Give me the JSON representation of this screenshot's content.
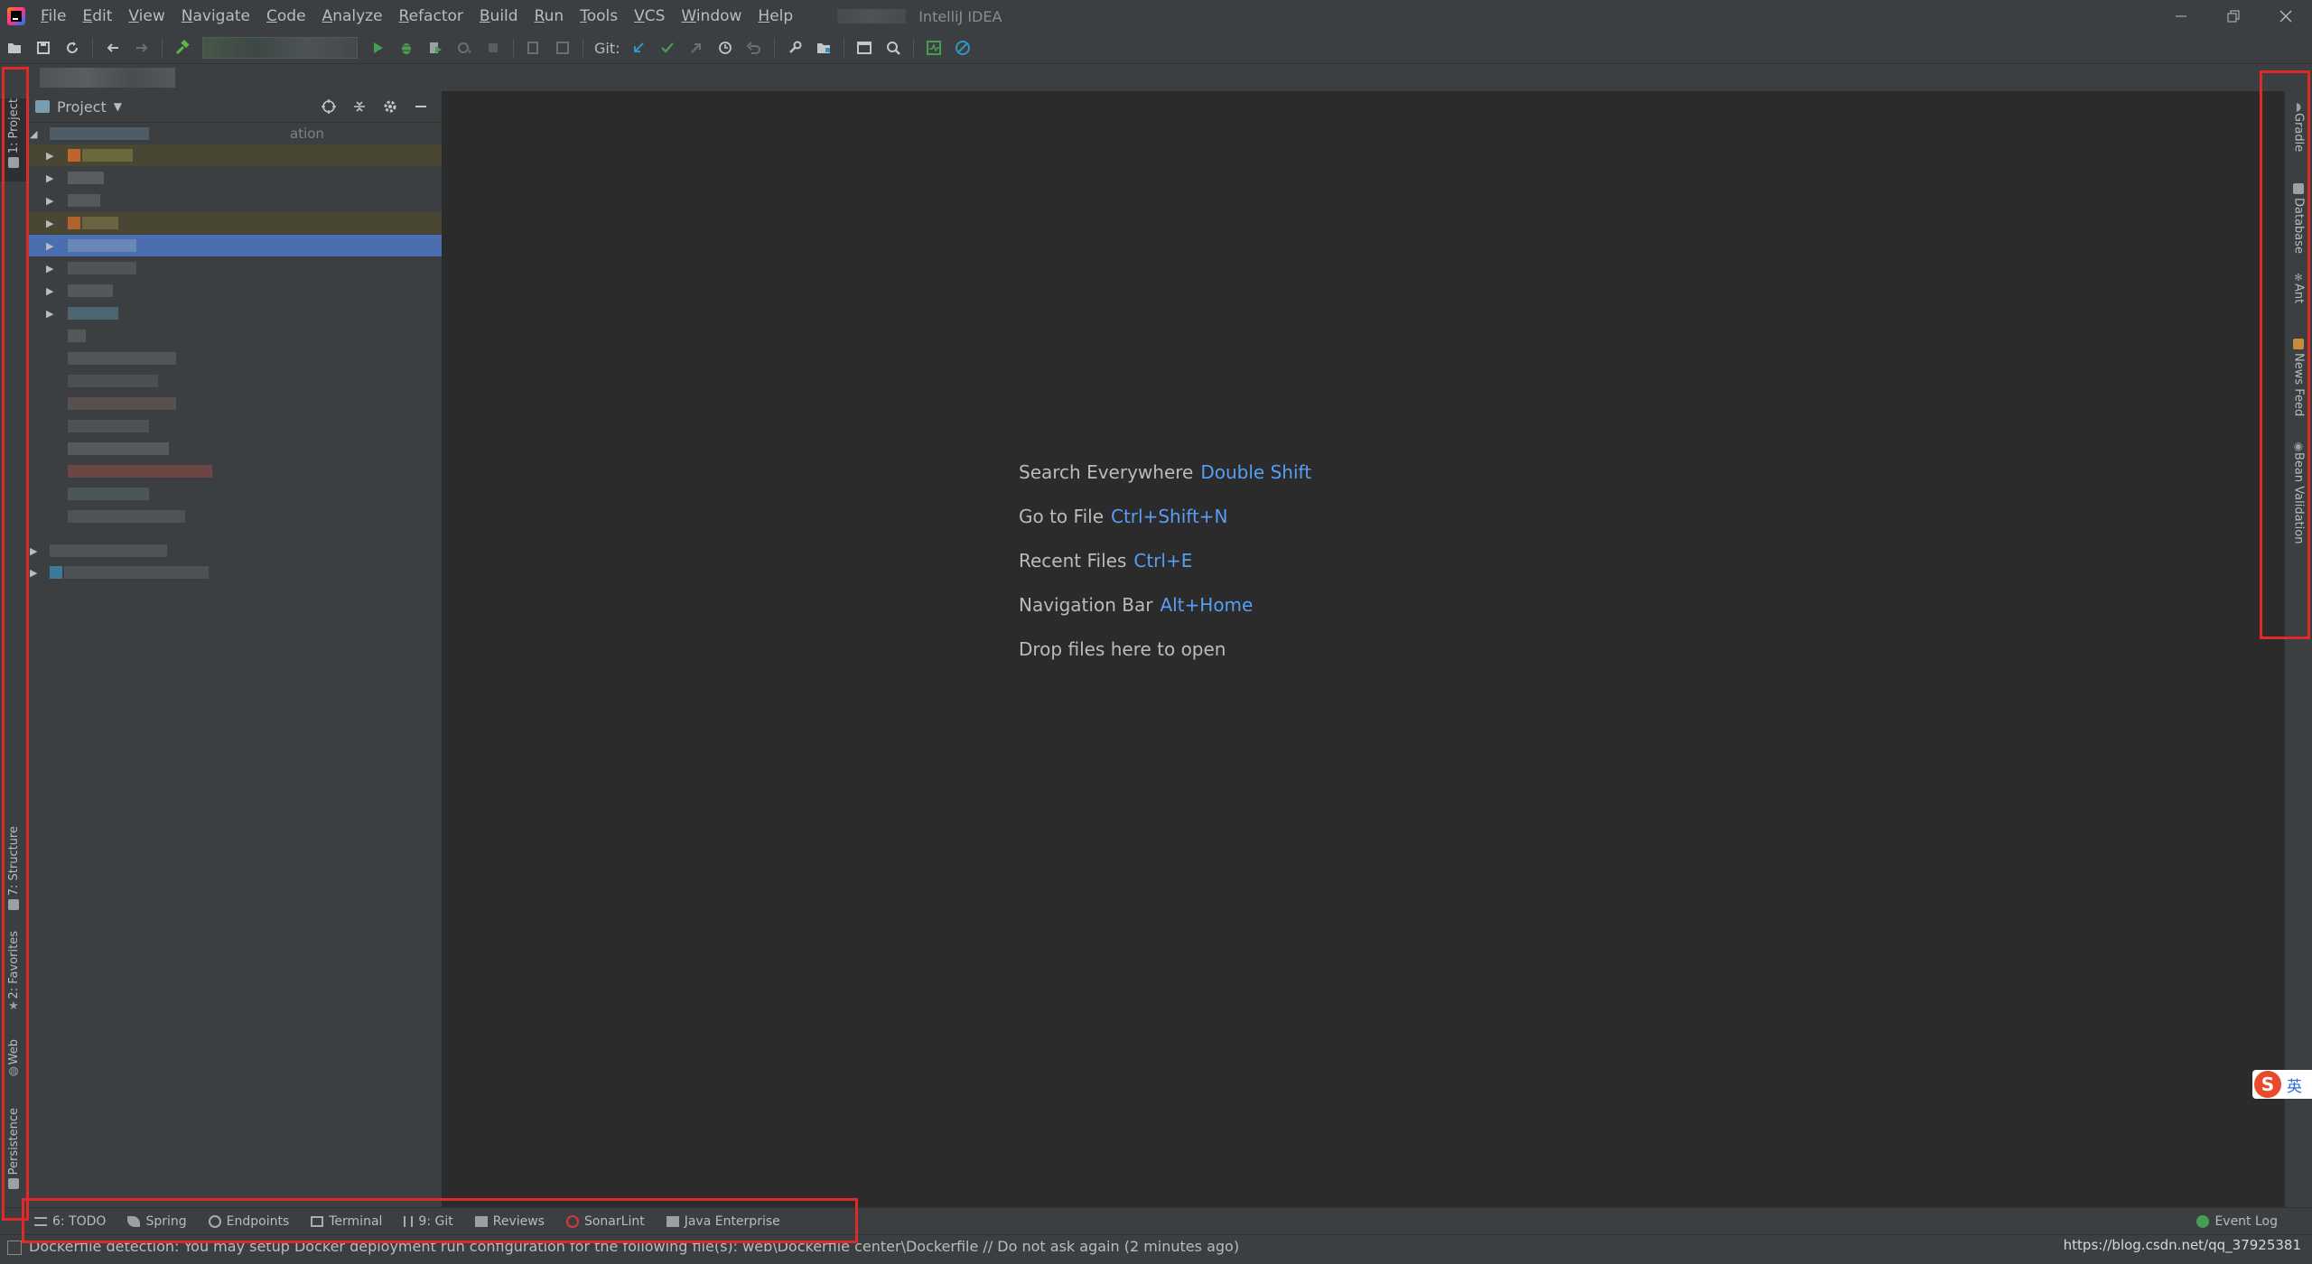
{
  "menubar": {
    "items": [
      "File",
      "Edit",
      "View",
      "Navigate",
      "Code",
      "Analyze",
      "Refactor",
      "Build",
      "Run",
      "Tools",
      "VCS",
      "Window",
      "Help"
    ],
    "window_title": "IntelliJ IDEA"
  },
  "toolbar": {
    "git_label": "Git:"
  },
  "project_panel": {
    "title": "Project",
    "partial_text": "ation"
  },
  "left_stripe": {
    "project": "1: Project",
    "structure": "7: Structure",
    "favorites": "2: Favorites",
    "web": "Web",
    "persistence": "Persistence"
  },
  "right_stripe": {
    "gradle": "Gradle",
    "database": "Database",
    "ant": "Ant",
    "news_feed": "News Feed",
    "bean_validation": "Bean Validation"
  },
  "editor_hints": [
    {
      "label": "Search Everywhere",
      "key": "Double Shift"
    },
    {
      "label": "Go to File",
      "key": "Ctrl+Shift+N"
    },
    {
      "label": "Recent Files",
      "key": "Ctrl+E"
    },
    {
      "label": "Navigation Bar",
      "key": "Alt+Home"
    },
    {
      "label": "Drop files here to open",
      "key": ""
    }
  ],
  "bottom_tools": [
    "6: TODO",
    "Spring",
    "Endpoints",
    "Terminal",
    "9: Git",
    "Reviews",
    "SonarLint",
    "Java Enterprise"
  ],
  "event_log": "Event Log",
  "status": {
    "message": "Dockerfile detection: You may setup Docker deployment run configuration for the following file(s): web\\Dockerfile center\\Dockerfile // Do not ask again (2 minutes ago)",
    "watermark": "https://blog.csdn.net/qq_37925381"
  },
  "ime": {
    "logo": "S",
    "lang": "英"
  },
  "colors": {
    "accent_key": "#589df6",
    "selection": "#4b6eaf",
    "annotation_red": "#e02a2a"
  }
}
